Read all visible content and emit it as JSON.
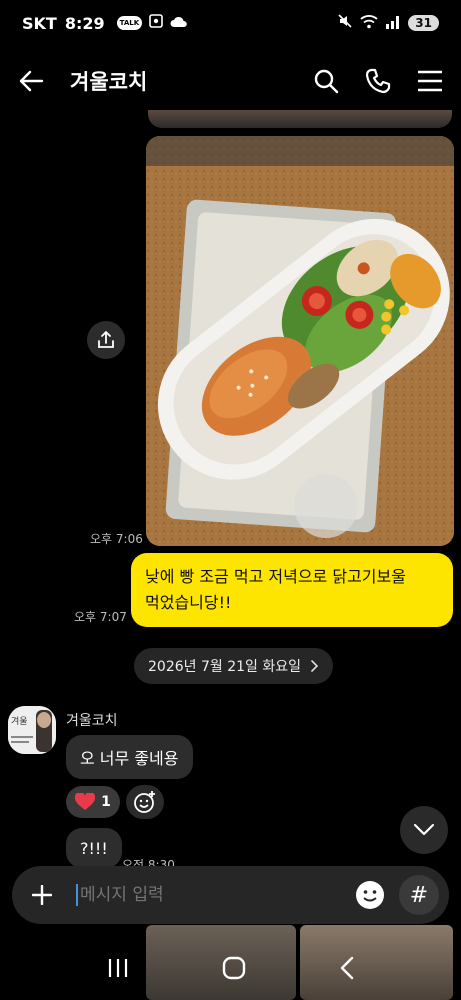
{
  "status_bar": {
    "carrier": "SKT",
    "time": "8:29",
    "talk_badge": "TALK",
    "battery": "31"
  },
  "header": {
    "title": "겨울코치"
  },
  "messages": {
    "photo_time": "오후 7:06",
    "yellow_text_line1": "낮에 빵 조금 먹고 저녁으로 닭고기보울",
    "yellow_text_line2": "먹었습니당!!",
    "yellow_time": "오후 7:07"
  },
  "date_divider": {
    "label": "2026년 7월 21일 화요일"
  },
  "coach": {
    "name": "겨울코치",
    "avatar_text": "겨울",
    "bubble1": "오 너무 좋네용",
    "reaction_count": "1",
    "bubble2": "?!!!",
    "bubble2_time": "오전 8:30"
  },
  "input": {
    "placeholder": "메시지 입력"
  },
  "icons": [
    "back-arrow-icon",
    "search-icon",
    "phone-icon",
    "menu-icon",
    "share-icon",
    "heart-icon",
    "add-emoji-icon",
    "chevron-down-icon",
    "plus-icon",
    "emoji-icon",
    "hash-icon",
    "recent-apps-icon",
    "home-icon",
    "nav-back-icon"
  ],
  "colors": {
    "my_bubble": "#fee500",
    "other_bubble": "#2d2d2d",
    "background": "#000000",
    "heart": "#e83a4a"
  }
}
